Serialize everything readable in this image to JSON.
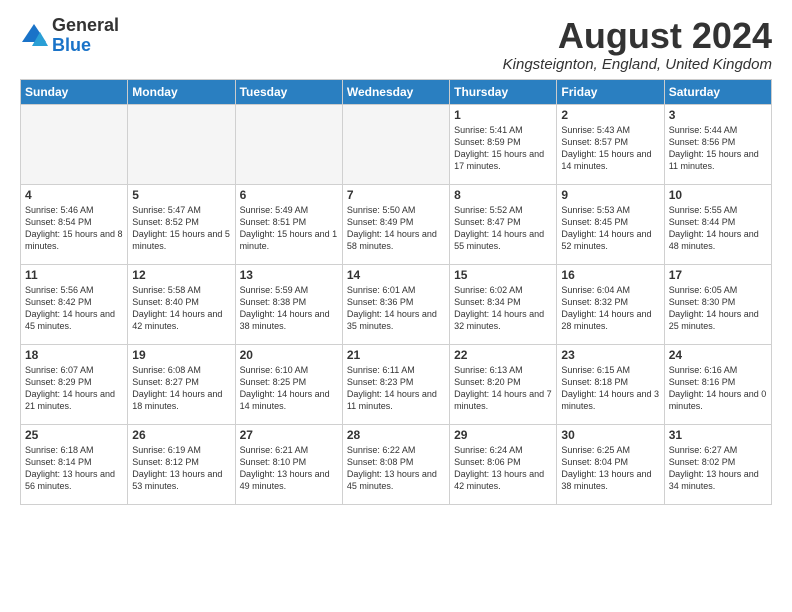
{
  "header": {
    "logo_general": "General",
    "logo_blue": "Blue",
    "month_year": "August 2024",
    "location": "Kingsteignton, England, United Kingdom"
  },
  "days_of_week": [
    "Sunday",
    "Monday",
    "Tuesday",
    "Wednesday",
    "Thursday",
    "Friday",
    "Saturday"
  ],
  "weeks": [
    [
      {
        "day": "",
        "empty": true
      },
      {
        "day": "",
        "empty": true
      },
      {
        "day": "",
        "empty": true
      },
      {
        "day": "",
        "empty": true
      },
      {
        "day": "1",
        "sunrise": "5:41 AM",
        "sunset": "8:59 PM",
        "daylight": "15 hours and 17 minutes."
      },
      {
        "day": "2",
        "sunrise": "5:43 AM",
        "sunset": "8:57 PM",
        "daylight": "15 hours and 14 minutes."
      },
      {
        "day": "3",
        "sunrise": "5:44 AM",
        "sunset": "8:56 PM",
        "daylight": "15 hours and 11 minutes."
      }
    ],
    [
      {
        "day": "4",
        "sunrise": "5:46 AM",
        "sunset": "8:54 PM",
        "daylight": "15 hours and 8 minutes."
      },
      {
        "day": "5",
        "sunrise": "5:47 AM",
        "sunset": "8:52 PM",
        "daylight": "15 hours and 5 minutes."
      },
      {
        "day": "6",
        "sunrise": "5:49 AM",
        "sunset": "8:51 PM",
        "daylight": "15 hours and 1 minute."
      },
      {
        "day": "7",
        "sunrise": "5:50 AM",
        "sunset": "8:49 PM",
        "daylight": "14 hours and 58 minutes."
      },
      {
        "day": "8",
        "sunrise": "5:52 AM",
        "sunset": "8:47 PM",
        "daylight": "14 hours and 55 minutes."
      },
      {
        "day": "9",
        "sunrise": "5:53 AM",
        "sunset": "8:45 PM",
        "daylight": "14 hours and 52 minutes."
      },
      {
        "day": "10",
        "sunrise": "5:55 AM",
        "sunset": "8:44 PM",
        "daylight": "14 hours and 48 minutes."
      }
    ],
    [
      {
        "day": "11",
        "sunrise": "5:56 AM",
        "sunset": "8:42 PM",
        "daylight": "14 hours and 45 minutes."
      },
      {
        "day": "12",
        "sunrise": "5:58 AM",
        "sunset": "8:40 PM",
        "daylight": "14 hours and 42 minutes."
      },
      {
        "day": "13",
        "sunrise": "5:59 AM",
        "sunset": "8:38 PM",
        "daylight": "14 hours and 38 minutes."
      },
      {
        "day": "14",
        "sunrise": "6:01 AM",
        "sunset": "8:36 PM",
        "daylight": "14 hours and 35 minutes."
      },
      {
        "day": "15",
        "sunrise": "6:02 AM",
        "sunset": "8:34 PM",
        "daylight": "14 hours and 32 minutes."
      },
      {
        "day": "16",
        "sunrise": "6:04 AM",
        "sunset": "8:32 PM",
        "daylight": "14 hours and 28 minutes."
      },
      {
        "day": "17",
        "sunrise": "6:05 AM",
        "sunset": "8:30 PM",
        "daylight": "14 hours and 25 minutes."
      }
    ],
    [
      {
        "day": "18",
        "sunrise": "6:07 AM",
        "sunset": "8:29 PM",
        "daylight": "14 hours and 21 minutes."
      },
      {
        "day": "19",
        "sunrise": "6:08 AM",
        "sunset": "8:27 PM",
        "daylight": "14 hours and 18 minutes."
      },
      {
        "day": "20",
        "sunrise": "6:10 AM",
        "sunset": "8:25 PM",
        "daylight": "14 hours and 14 minutes."
      },
      {
        "day": "21",
        "sunrise": "6:11 AM",
        "sunset": "8:23 PM",
        "daylight": "14 hours and 11 minutes."
      },
      {
        "day": "22",
        "sunrise": "6:13 AM",
        "sunset": "8:20 PM",
        "daylight": "14 hours and 7 minutes."
      },
      {
        "day": "23",
        "sunrise": "6:15 AM",
        "sunset": "8:18 PM",
        "daylight": "14 hours and 3 minutes."
      },
      {
        "day": "24",
        "sunrise": "6:16 AM",
        "sunset": "8:16 PM",
        "daylight": "14 hours and 0 minutes."
      }
    ],
    [
      {
        "day": "25",
        "sunrise": "6:18 AM",
        "sunset": "8:14 PM",
        "daylight": "13 hours and 56 minutes."
      },
      {
        "day": "26",
        "sunrise": "6:19 AM",
        "sunset": "8:12 PM",
        "daylight": "13 hours and 53 minutes."
      },
      {
        "day": "27",
        "sunrise": "6:21 AM",
        "sunset": "8:10 PM",
        "daylight": "13 hours and 49 minutes."
      },
      {
        "day": "28",
        "sunrise": "6:22 AM",
        "sunset": "8:08 PM",
        "daylight": "13 hours and 45 minutes."
      },
      {
        "day": "29",
        "sunrise": "6:24 AM",
        "sunset": "8:06 PM",
        "daylight": "13 hours and 42 minutes."
      },
      {
        "day": "30",
        "sunrise": "6:25 AM",
        "sunset": "8:04 PM",
        "daylight": "13 hours and 38 minutes."
      },
      {
        "day": "31",
        "sunrise": "6:27 AM",
        "sunset": "8:02 PM",
        "daylight": "13 hours and 34 minutes."
      }
    ]
  ]
}
